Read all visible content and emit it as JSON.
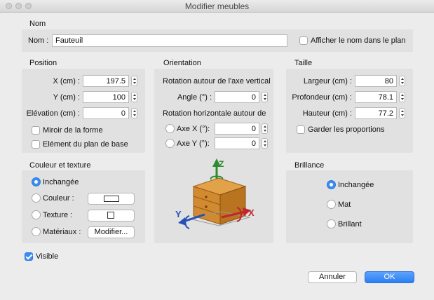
{
  "window": {
    "title": "Modifier meubles"
  },
  "name_section": {
    "header": "Nom",
    "label": "Nom :",
    "value": "Fauteuil",
    "show_in_plan": "Afficher le nom dans le plan"
  },
  "position": {
    "header": "Position",
    "x_label": "X (cm) :",
    "x_value": "197.5",
    "y_label": "Y (cm) :",
    "y_value": "100",
    "elev_label": "Elévation (cm) :",
    "elev_value": "0",
    "mirror": "Miroir de la forme",
    "base_plan": "Elément du plan de base"
  },
  "orientation": {
    "header": "Orientation",
    "vertical_axis": "Rotation autour de l'axe vertical",
    "angle_label": "Angle (°) :",
    "angle_value": "0",
    "horizontal_axis": "Rotation horizontale autour de",
    "axis_x_label": "Axe X (°):",
    "axis_x_value": "0",
    "axis_y_label": "Axe Y (°):",
    "axis_y_value": "0",
    "axis_labels": {
      "z": "Z",
      "x": "X",
      "y": "Y"
    }
  },
  "size": {
    "header": "Taille",
    "width_label": "Largeur (cm) :",
    "width_value": "80",
    "depth_label": "Profondeur (cm) :",
    "depth_value": "78.1",
    "height_label": "Hauteur (cm) :",
    "height_value": "77.2",
    "keep_proportions": "Garder les proportions"
  },
  "color_texture": {
    "header": "Couleur et texture",
    "unchanged": "Inchangée",
    "color": "Couleur :",
    "texture": "Texture :",
    "materials": "Matériaux :",
    "modify_button": "Modifier..."
  },
  "shininess": {
    "header": "Brillance",
    "unchanged": "Inchangée",
    "matt": "Mat",
    "shiny": "Brillant"
  },
  "visible": "Visible",
  "buttons": {
    "cancel": "Annuler",
    "ok": "OK"
  }
}
